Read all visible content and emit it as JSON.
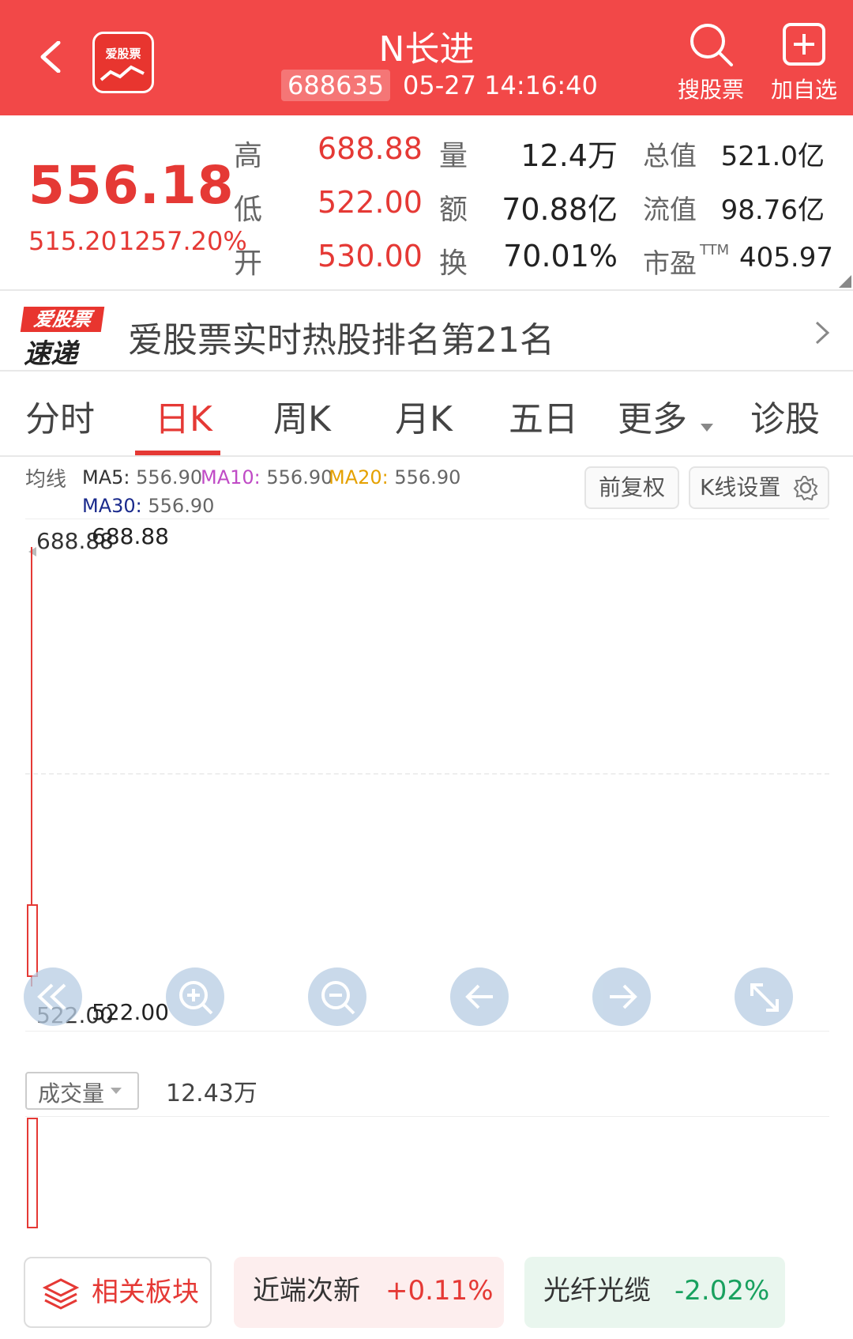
{
  "header": {
    "title": "N长进",
    "code": "688635",
    "time": "05-27 14:16:40",
    "logo_text": "爱股票",
    "search_label": "搜股票",
    "add_label": "加自选"
  },
  "quote": {
    "price": "556.18",
    "change": "515.20",
    "change_pct": "1257.20%",
    "high_label": "高",
    "high": "688.88",
    "low_label": "低",
    "low": "522.00",
    "open_label": "开",
    "open": "530.00",
    "vol_label": "量",
    "vol": "12.4万",
    "amt_label": "额",
    "amt": "70.88亿",
    "turn_label": "换",
    "turn": "70.01%",
    "mcap_label": "总值",
    "mcap": "521.0亿",
    "fcap_label": "流值",
    "fcap": "98.76亿",
    "pe_label": "市盈",
    "pe_sup": "TTM",
    "pe": "405.97"
  },
  "banner": {
    "logo_top": "爱股票",
    "logo_bottom": "速递",
    "text": "爱股票实时热股排名第21名"
  },
  "tabs": [
    "分时",
    "日K",
    "周K",
    "月K",
    "五日",
    "更多",
    "诊股"
  ],
  "active_tab": "日K",
  "ma": {
    "label": "均线",
    "ma5_label": "MA5:",
    "ma5": "556.90",
    "ma10_label": "MA10:",
    "ma10": "556.90",
    "ma20_label": "MA20:",
    "ma20": "556.90",
    "ma30_label": "MA30:",
    "ma30": "556.90",
    "adjust_label": "前复权",
    "settings_label": "K线设置"
  },
  "chart": {
    "high_label": "688.88",
    "low_label": "522.00"
  },
  "volume": {
    "selector_label": "成交量",
    "value": "12.43万"
  },
  "bottom": {
    "related_label": "相关板块",
    "sector1_name": "近端次新",
    "sector1_change": "+0.11%",
    "sector2_name": "光纤光缆",
    "sector2_change": "-2.02%"
  },
  "colors": {
    "header_bg": "#f24848",
    "up": "#e53935",
    "down": "#19a15f",
    "ma5": "#333333",
    "ma10": "#c04bc6",
    "ma20": "#e5a100",
    "ma30": "#1a2a8c"
  },
  "icons": [
    "back-icon",
    "search-icon",
    "add-icon",
    "chevron-right-icon",
    "gear-icon",
    "layers-icon",
    "zoom-in-icon",
    "zoom-out-icon",
    "arrow-left-icon",
    "arrow-right-icon",
    "expand-icon",
    "rewind-icon"
  ]
}
